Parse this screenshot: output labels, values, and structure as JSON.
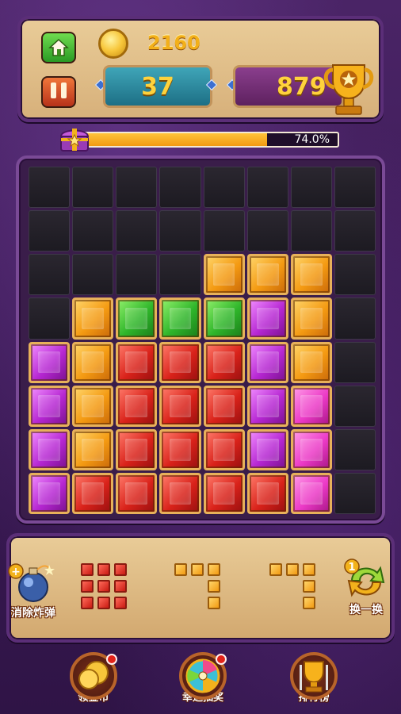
{
  "header": {
    "coins": "2160",
    "current_score": "37",
    "best_score": "879"
  },
  "progress": {
    "percent_text": "74.0%",
    "fraction": 0.74
  },
  "board": {
    "rows": [
      [
        "",
        "",
        "",
        "",
        "",
        "",
        "",
        ""
      ],
      [
        "",
        "",
        "",
        "",
        "",
        "",
        "",
        ""
      ],
      [
        "",
        "",
        "",
        "",
        "orange",
        "orange",
        "orange",
        ""
      ],
      [
        "",
        "orange",
        "green",
        "green",
        "green",
        "purple",
        "orange",
        ""
      ],
      [
        "purple",
        "orange",
        "red",
        "red",
        "red",
        "purple",
        "orange",
        ""
      ],
      [
        "purple",
        "orange",
        "red",
        "red",
        "red",
        "purple",
        "pink",
        ""
      ],
      [
        "purple",
        "orange",
        "red",
        "red",
        "red",
        "purple",
        "pink",
        ""
      ],
      [
        "purple",
        "red",
        "red",
        "red",
        "red",
        "red",
        "pink",
        ""
      ]
    ]
  },
  "tray": {
    "bomb_label": "消除炸弹",
    "bomb_count_symbol": "+",
    "swap_label": "换一换",
    "swap_count": "1",
    "pieces": [
      {
        "color": "red",
        "shape": [
          [
            1,
            1,
            1
          ],
          [
            1,
            1,
            1
          ],
          [
            1,
            1,
            1
          ]
        ]
      },
      {
        "color": "orange",
        "shape": [
          [
            1,
            1,
            1
          ],
          [
            0,
            0,
            1
          ],
          [
            0,
            0,
            1
          ]
        ]
      },
      {
        "color": "orange",
        "shape": [
          [
            1,
            1,
            1
          ],
          [
            0,
            0,
            1
          ],
          [
            0,
            0,
            1
          ]
        ]
      }
    ]
  },
  "nav": {
    "coins_label": "领金币",
    "lottery_label": "幸运抽奖",
    "ranking_label": "排行榜"
  },
  "icons": {
    "home": "home-icon",
    "pause": "pause-icon",
    "coin": "coin-icon",
    "trophy": "trophy-icon",
    "chest": "treasure-chest-icon",
    "bomb": "bomb-icon",
    "swap": "swap-arrows-icon",
    "wheel": "lucky-wheel-icon",
    "cup": "ranking-cup-icon"
  }
}
